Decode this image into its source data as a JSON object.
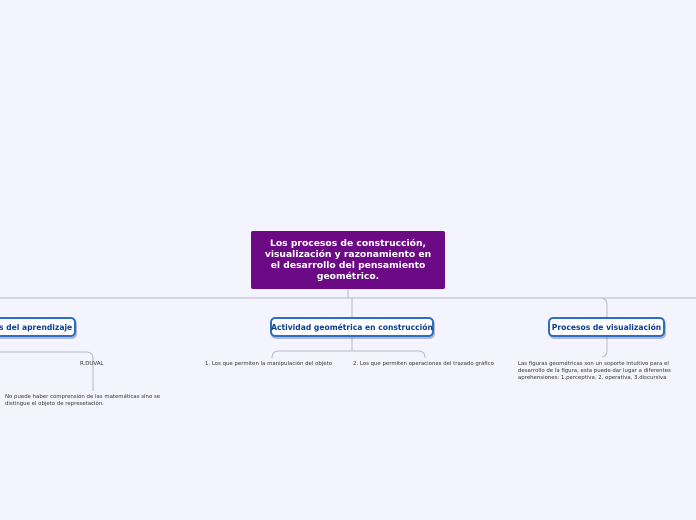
{
  "root": {
    "title": "Los procesos de construcción, visualización y razonamiento en el desarrollo del pensamiento geométrico."
  },
  "topics": {
    "left": {
      "label": "os del aprendizaje",
      "children": {
        "r_duval": "R.DUVAL",
        "nota": "No puede haber comprensión de las matemáticas sino se distingue el objeto de represetación."
      }
    },
    "center": {
      "label": "Actividad geométrica en construcción",
      "children": {
        "manipulacion": "1. Los que permiten la manipulación del objeto",
        "trazado": "2. Los que permiten operaciones del trazado gráfico"
      }
    },
    "right": {
      "label": "Procesos de visualización",
      "children": {
        "figuras": "Las figuras geométricas son un soporte intuitivo para el desarrollo de la figura, esta puede dar lugar a diferentes aprehensiones: 1.perceptiva. 2. operativa, 3.discursiva"
      }
    }
  },
  "colors": {
    "background": "#f3f4fd",
    "root_fill": "#6c0a86",
    "root_text": "#ffffff",
    "topic_border": "#2a6fc1",
    "topic_text": "#0b3d91",
    "connector": "#b8b9c8"
  }
}
